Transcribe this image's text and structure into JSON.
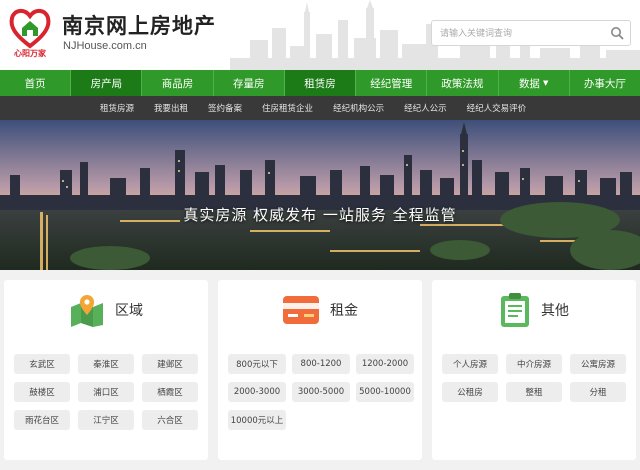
{
  "header": {
    "title": "南京网上房地产",
    "url": "NJHouse.com.cn",
    "logo_text": "心阳万家",
    "search_placeholder": "请输入关键词查询"
  },
  "mainnav": [
    {
      "label": "首页"
    },
    {
      "label": "房产局"
    },
    {
      "label": "商品房"
    },
    {
      "label": "存量房"
    },
    {
      "label": "租赁房"
    },
    {
      "label": "经纪管理"
    },
    {
      "label": "政策法规"
    },
    {
      "label": "数据"
    },
    {
      "label": "办事大厅"
    }
  ],
  "subnav": [
    {
      "label": "租赁房源"
    },
    {
      "label": "我要出租"
    },
    {
      "label": "签约备案"
    },
    {
      "label": "住房租赁企业"
    },
    {
      "label": "经纪机构公示"
    },
    {
      "label": "经纪人公示"
    },
    {
      "label": "经纪人交易评价"
    }
  ],
  "banner": {
    "slogan": "真实房源  权威发布  一站服务  全程监管"
  },
  "cards": {
    "area": {
      "title": "区域",
      "icon": "map-pin-icon",
      "items": [
        "玄武区",
        "秦淮区",
        "建邺区",
        "鼓楼区",
        "浦口区",
        "栖霞区",
        "雨花台区",
        "江宁区",
        "六合区"
      ]
    },
    "rent": {
      "title": "租金",
      "icon": "card-icon",
      "items": [
        "800元以下",
        "800-1200",
        "1200-2000",
        "2000-3000",
        "3000-5000",
        "5000-10000",
        "10000元以上"
      ]
    },
    "other": {
      "title": "其他",
      "icon": "clipboard-icon",
      "items": [
        "个人房源",
        "中介房源",
        "公寓房源",
        "公租房",
        "整租",
        "分租"
      ]
    }
  },
  "colors": {
    "nav_green": "#2f9a29",
    "nav_active": "#1c7a17",
    "subnav_bg": "#393939",
    "logo_red": "#d9232e"
  }
}
